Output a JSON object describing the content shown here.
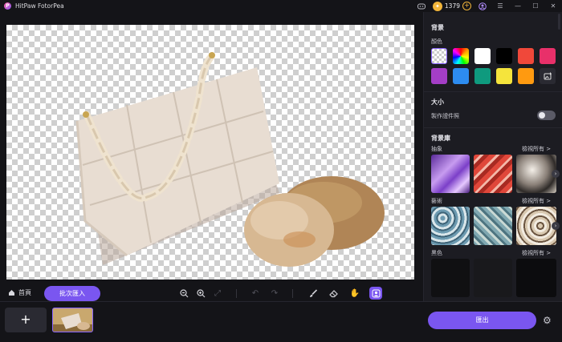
{
  "app": {
    "title": "HitPaw FotorPea",
    "coins": "1379"
  },
  "panel": {
    "background_title": "背景",
    "color_label": "顏色",
    "swatch_colors": [
      "#ffffff",
      "#000000",
      "#f0483a",
      "#e8306a",
      "#a43ec6",
      "#2d8cf0",
      "#0f9a7e",
      "#f5e43c",
      "#ff9a10"
    ],
    "size_title": "大小",
    "id_photo_label": "製作證件照",
    "library_title": "背景庫",
    "categories": [
      {
        "name": "抽象",
        "view_all": "檢視所有 >"
      },
      {
        "name": "藝術",
        "view_all": "檢視所有 >"
      },
      {
        "name": "黑色",
        "view_all": "檢視所有 >"
      }
    ]
  },
  "toolbar": {
    "home_label": "首頁",
    "batch_import_label": "批次匯入"
  },
  "footer": {
    "add_label": "+",
    "export_label": "匯出"
  },
  "icons": [
    "discord-icon",
    "coin-icon",
    "add-coins-icon",
    "user-icon",
    "settings-icon",
    "minimize-icon",
    "maximize-icon",
    "close-icon",
    "zoom-out-icon",
    "zoom-in-icon",
    "fit-icon",
    "undo-icon",
    "redo-icon",
    "brush-icon",
    "eraser-icon",
    "hand-icon",
    "portrait-icon",
    "gear-icon",
    "home-icon"
  ]
}
